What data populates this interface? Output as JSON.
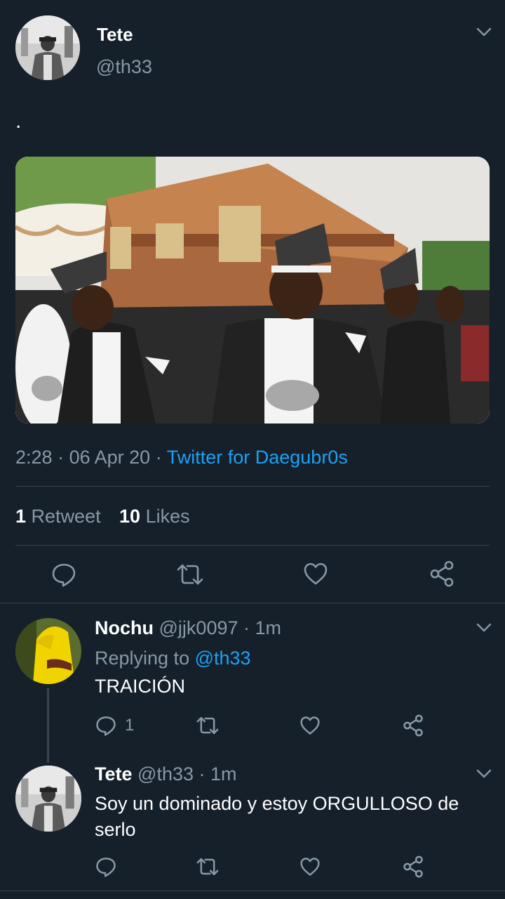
{
  "main_tweet": {
    "name": "Tete",
    "handle": "@th33",
    "text": ".",
    "time": "2:28",
    "date": "06 Apr 20",
    "source": "Twitter for Daegubr0s",
    "sep": "·",
    "retweet_count": "1",
    "retweet_label": "Retweet",
    "like_count": "10",
    "like_label": "Likes"
  },
  "replies": [
    {
      "name": "Nochu",
      "handle": "@jjk0097",
      "time": "1m",
      "replying_prefix": "Replying to",
      "replying_to": "@th33",
      "text": "TRAICIÓN",
      "reply_count": "1"
    },
    {
      "name": "Tete",
      "handle": "@th33",
      "time": "1m",
      "text_line1": "Soy un dominado y estoy ORGULLOSO de",
      "text_line2": "serlo"
    }
  ],
  "icons": {
    "reply": "reply-icon",
    "retweet": "retweet-icon",
    "like": "heart-icon",
    "share": "share-icon",
    "menu": "chevron-down-icon"
  },
  "colors": {
    "background": "#15202b",
    "accent": "#1da1f2",
    "muted": "#8899a6",
    "divider": "#38444d"
  }
}
